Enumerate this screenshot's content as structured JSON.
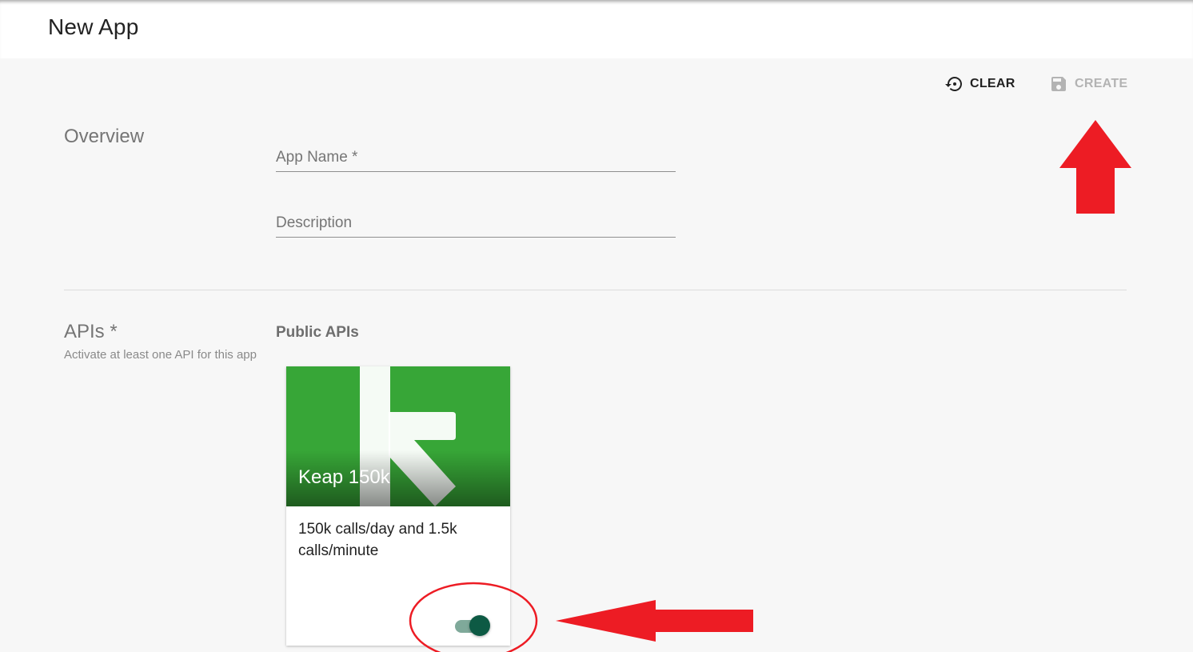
{
  "header": {
    "title": "New App"
  },
  "toolbar": {
    "clear_label": "CLEAR",
    "clear_icon": "restore-icon",
    "create_label": "CREATE",
    "create_icon": "save-icon",
    "create_enabled": false
  },
  "overview": {
    "heading": "Overview",
    "app_name": {
      "placeholder": "App Name *",
      "value": ""
    },
    "description": {
      "placeholder": "Description",
      "value": ""
    }
  },
  "apis": {
    "heading": "APIs *",
    "subtitle": "Activate at least one API for this app",
    "public_label": "Public APIs",
    "cards": [
      {
        "title": "Keap 150k",
        "description": "150k calls/day and 1.5k calls/minute",
        "logo": "keap-logo",
        "enabled": true
      }
    ]
  },
  "colors": {
    "card_media": "#37a637",
    "toggle_thumb": "#0d5a44",
    "toggle_track": "#7fa99a",
    "annotation_red": "#ed1c24",
    "disabled_text": "#b3b3b3"
  }
}
